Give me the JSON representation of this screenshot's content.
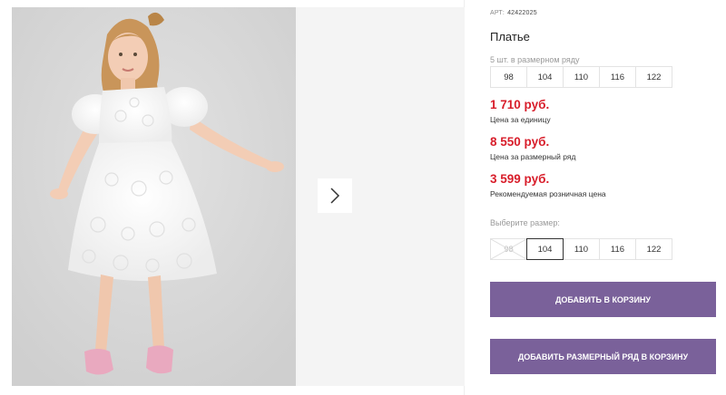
{
  "gallery": {
    "main_photo_alt": "",
    "next_icon": "chevron-right-icon"
  },
  "product": {
    "art_label": "АРТ",
    "art_number": "42422025",
    "title": "Платье",
    "pack_label": "5 шт. в размерном ряду",
    "pack_sizes": [
      "98",
      "104",
      "110",
      "116",
      "122"
    ],
    "prices": [
      {
        "value": "1 710 руб.",
        "caption": "Цена за единицу"
      },
      {
        "value": "8 550 руб.",
        "caption": "Цена за размерный ряд"
      },
      {
        "value": "3 599 руб.",
        "caption": "Рекомендуемая розничная цена"
      }
    ],
    "choose_label": "Выберите размер:",
    "choose_sizes": [
      {
        "label": "98",
        "state": "unavailable"
      },
      {
        "label": "104",
        "state": "selected"
      },
      {
        "label": "110",
        "state": "available"
      },
      {
        "label": "116",
        "state": "available"
      },
      {
        "label": "122",
        "state": "available"
      }
    ],
    "add_to_cart": "ДОБАВИТЬ В КОРЗИНУ",
    "add_pack_to_cart": "ДОБАВИТЬ РАЗМЕРНЫЙ РЯД В КОРЗИНУ"
  },
  "colors": {
    "price": "#d81e2b",
    "button": "#7a619a"
  }
}
